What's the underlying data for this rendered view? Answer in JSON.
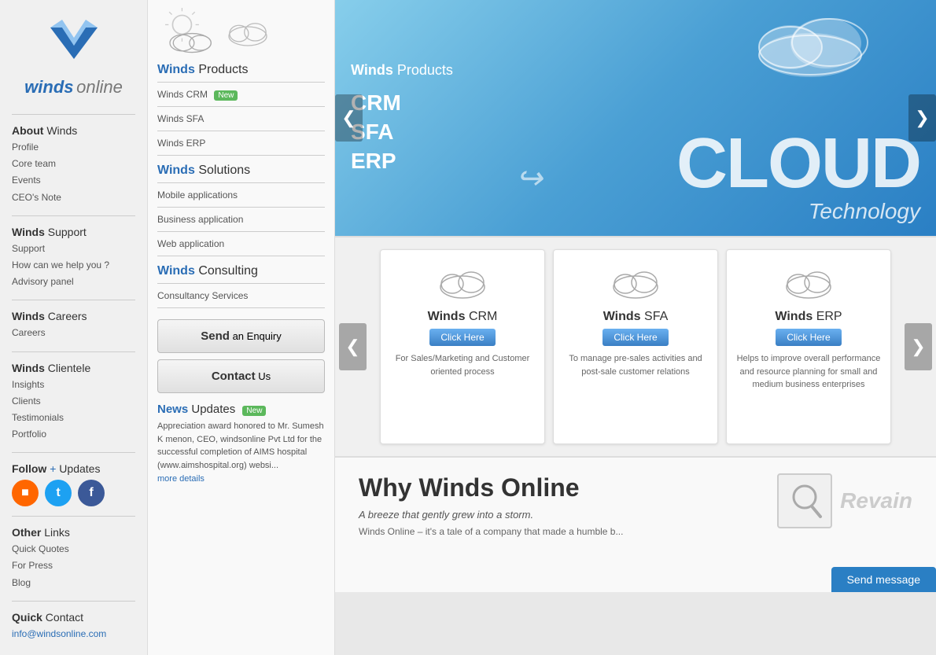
{
  "sidebar": {
    "logo": {
      "text_winds": "winds",
      "text_online": "online"
    },
    "about": {
      "title_bold": "About",
      "title_light": "Winds",
      "links": [
        "Profile",
        "Core team",
        "Events",
        "CEO's Note"
      ]
    },
    "support": {
      "title_bold": "Winds",
      "title_light": "Support",
      "links": [
        "Support",
        "How can we help you ?",
        "Advisory panel"
      ]
    },
    "careers": {
      "title_bold": "Winds",
      "title_light": "Careers",
      "links": [
        "Careers"
      ]
    },
    "clientele": {
      "title_bold": "Winds",
      "title_light": "Clientele",
      "links": [
        "Insights",
        "Clients",
        "Testimonials",
        "Portfolio"
      ]
    },
    "follow": {
      "title_bold": "Follow",
      "title_plus": "+",
      "title_light": "Updates"
    },
    "other": {
      "title_bold": "Other",
      "title_light": "Links",
      "links": [
        "Quick Quotes",
        "For Press",
        "Blog"
      ]
    },
    "contact": {
      "title_bold": "Quick",
      "title_light": "Contact",
      "email": "info@windsonline.com"
    }
  },
  "middle": {
    "products": {
      "title_bold": "Winds",
      "title_light": "Products",
      "items": [
        {
          "label": "Winds CRM",
          "badge": "New"
        },
        {
          "label": "Winds SFA",
          "badge": ""
        },
        {
          "label": "Winds ERP",
          "badge": ""
        }
      ]
    },
    "solutions": {
      "title_bold": "Winds",
      "title_light": "Solutions",
      "items": [
        {
          "label": "Mobile applications"
        },
        {
          "label": "Business application"
        },
        {
          "label": "Web application"
        }
      ]
    },
    "consulting": {
      "title_bold": "Winds",
      "title_light": "Consulting",
      "items": [
        {
          "label": "Consultancy Services"
        }
      ]
    },
    "send_enquiry": "Send an Enquiry",
    "send_bold": "Send",
    "send_light": "an Enquiry",
    "contact_bold": "Contact",
    "contact_light": "Us",
    "news": {
      "title_bold": "News",
      "title_light": "Updates",
      "badge": "New",
      "text": "Appreciation award honored to Mr. Sumesh K menon, CEO, windsonline Pvt Ltd for the successful completion of AIMS hospital (www.aimshospital.org) websi...",
      "more": "more details"
    }
  },
  "carousel": {
    "title_bold": "Winds",
    "title_light": "Products",
    "crm": "CRM",
    "sfa": "SFA",
    "erp": "ERP",
    "cloud_word": "CLOUD",
    "tech_word": "Technology",
    "arrow_left": "❮",
    "arrow_right": "❯"
  },
  "cards": [
    {
      "title_bold": "Winds",
      "title_light": "CRM",
      "btn": "Click Here",
      "desc": "For Sales/Marketing and Customer oriented process"
    },
    {
      "title_bold": "Winds",
      "title_light": "SFA",
      "btn": "Click Here",
      "desc": "To manage pre-sales activities and post-sale customer relations"
    },
    {
      "title_bold": "Winds",
      "title_light": "ERP",
      "btn": "Click Here",
      "desc": "Helps to improve overall performance and resource planning for small and medium business enterprises"
    }
  ],
  "why": {
    "title": "Why Winds Online",
    "subtitle": "A breeze that gently grew into a storm.",
    "body": "Winds Online – it's a tale of a company that made a humble b..."
  },
  "revain": {
    "label": "Revain"
  },
  "send_message": {
    "label": "Send message"
  }
}
